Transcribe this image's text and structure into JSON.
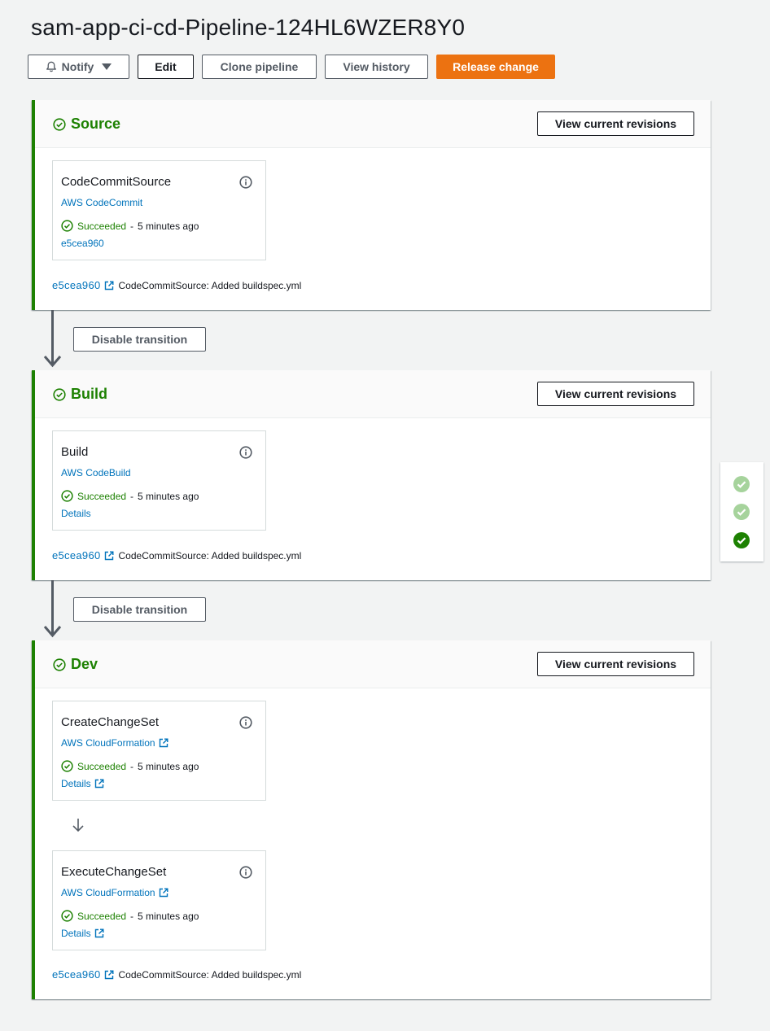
{
  "pipeline": {
    "title": "sam-app-ci-cd-Pipeline-124HL6WZER8Y0"
  },
  "toolbar": {
    "notify_label": "Notify",
    "edit_label": "Edit",
    "clone_label": "Clone pipeline",
    "history_label": "View history",
    "release_label": "Release change"
  },
  "colors": {
    "success": "#1d8102",
    "link": "#0073bb",
    "primary": "#ec7211"
  },
  "stages": [
    {
      "name": "Source",
      "view_revisions_label": "View current revisions",
      "actions": [
        {
          "name": "CodeCommitSource",
          "provider": "AWS CodeCommit",
          "status": "Succeeded",
          "sep": "-",
          "time": "5 minutes ago",
          "link": "e5cea960"
        }
      ],
      "revision": {
        "id": "e5cea960",
        "message": "CodeCommitSource: Added buildspec.yml"
      }
    },
    {
      "name": "Build",
      "view_revisions_label": "View current revisions",
      "actions": [
        {
          "name": "Build",
          "provider": "AWS CodeBuild",
          "status": "Succeeded",
          "sep": "-",
          "time": "5 minutes ago",
          "link": "Details"
        }
      ],
      "revision": {
        "id": "e5cea960",
        "message": "CodeCommitSource: Added buildspec.yml"
      }
    },
    {
      "name": "Dev",
      "view_revisions_label": "View current revisions",
      "actions": [
        {
          "name": "CreateChangeSet",
          "provider": "AWS CloudFormation",
          "status": "Succeeded",
          "sep": "-",
          "time": "5 minutes ago",
          "link": "Details"
        },
        {
          "name": "ExecuteChangeSet",
          "provider": "AWS CloudFormation",
          "status": "Succeeded",
          "sep": "-",
          "time": "5 minutes ago",
          "link": "Details"
        }
      ],
      "revision": {
        "id": "e5cea960",
        "message": "CodeCommitSource: Added buildspec.yml"
      }
    }
  ],
  "transitions": [
    {
      "label": "Disable transition"
    },
    {
      "label": "Disable transition"
    }
  ]
}
